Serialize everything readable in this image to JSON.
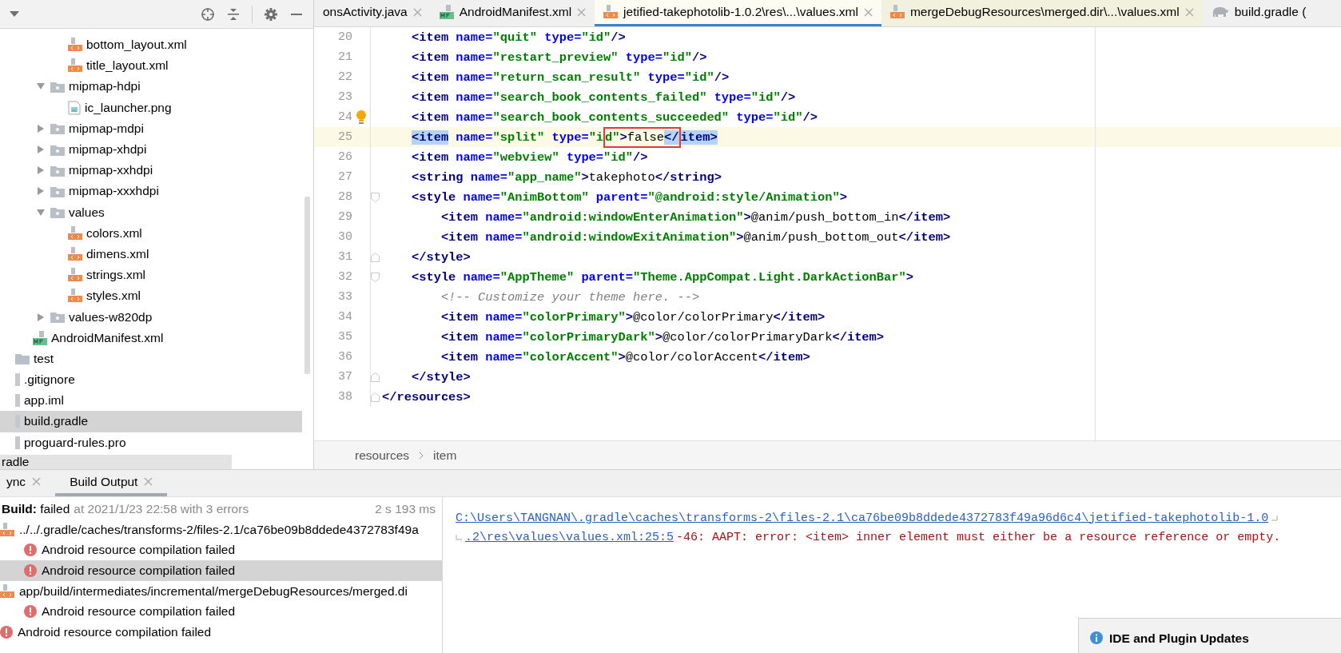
{
  "project_panel": {
    "tree": [
      {
        "children": [
          {
            "children": [
              {
                "children": [
                  {
                    "children": [
                      {
                        "label": "bottom_layout.xml",
                        "kind": "xml",
                        "selected": false
                      },
                      {
                        "label": "title_layout.xml",
                        "kind": "xml",
                        "selected": false
                      }
                    ]
                  },
                  {
                    "label": "mipmap-hdpi",
                    "kind": "folder",
                    "expanded": true,
                    "selected": false,
                    "children": [
                      {
                        "label": "ic_launcher.png",
                        "kind": "png",
                        "selected": false
                      }
                    ]
                  },
                  {
                    "label": "mipmap-mdpi",
                    "kind": "folder",
                    "expanded": false,
                    "selected": false
                  },
                  {
                    "label": "mipmap-xhdpi",
                    "kind": "folder",
                    "expanded": false,
                    "selected": false
                  },
                  {
                    "label": "mipmap-xxhdpi",
                    "kind": "folder",
                    "expanded": false,
                    "selected": false
                  },
                  {
                    "label": "mipmap-xxxhdpi",
                    "kind": "folder",
                    "expanded": false,
                    "selected": false
                  },
                  {
                    "label": "values",
                    "kind": "folder",
                    "expanded": true,
                    "selected": false,
                    "children": [
                      {
                        "label": "colors.xml",
                        "kind": "xml",
                        "selected": false
                      },
                      {
                        "label": "dimens.xml",
                        "kind": "xml",
                        "selected": false
                      },
                      {
                        "label": "strings.xml",
                        "kind": "xml",
                        "selected": false
                      },
                      {
                        "label": "styles.xml",
                        "kind": "xml",
                        "selected": false
                      }
                    ]
                  },
                  {
                    "label": "values-w820dp",
                    "kind": "folder",
                    "expanded": false,
                    "selected": false
                  }
                ]
              },
              {
                "label": "AndroidManifest.xml",
                "kind": "manifest",
                "selected": false
              }
            ]
          },
          {
            "label": "test",
            "kind": "plainfolder",
            "selected": false
          }
        ]
      },
      {
        "label": ".gitignore",
        "kind": "file",
        "selected": false
      },
      {
        "label": "app.iml",
        "kind": "file",
        "selected": false
      },
      {
        "label": "build.gradle",
        "kind": "file",
        "selected": true
      },
      {
        "label": "proguard-rules.pro",
        "kind": "file",
        "selected": false
      }
    ],
    "footer": "radle"
  },
  "editor": {
    "tabs": [
      {
        "label": "onsActivity.java",
        "kind": "plain",
        "library": false,
        "selected": false
      },
      {
        "label": "AndroidManifest.xml",
        "kind": "manifest",
        "library": false,
        "selected": false
      },
      {
        "label": "jetified-takephotolib-1.0.2\\res\\...\\values.xml",
        "kind": "xml",
        "library": true,
        "selected": true
      },
      {
        "label": "mergeDebugResources\\merged.dir\\...\\values.xml",
        "kind": "xml",
        "library": true,
        "selected": false
      },
      {
        "label": "build.gradle (",
        "kind": "gradle",
        "library": false,
        "selected": false
      }
    ],
    "lines": [
      {
        "children": [
          {
            "number": "20",
            "current": false,
            "tokens": [
              {
                "kind": "tag",
                "text": "<item"
              },
              {
                "kind": "attr",
                "text": " name="
              },
              {
                "kind": "str",
                "text": "\"quit\""
              },
              {
                "kind": "attr",
                "text": " type="
              },
              {
                "kind": "str",
                "text": "\"id\""
              },
              {
                "kind": "tag",
                "text": "/>"
              }
            ]
          },
          {
            "number": "21",
            "current": false,
            "tokens": [
              {
                "kind": "tag",
                "text": "<item"
              },
              {
                "kind": "attr",
                "text": " name="
              },
              {
                "kind": "str",
                "text": "\"restart_preview\""
              },
              {
                "kind": "attr",
                "text": " type="
              },
              {
                "kind": "str",
                "text": "\"id\""
              },
              {
                "kind": "tag",
                "text": "/>"
              }
            ]
          },
          {
            "number": "22",
            "current": false,
            "tokens": [
              {
                "kind": "tag",
                "text": "<item"
              },
              {
                "kind": "attr",
                "text": " name="
              },
              {
                "kind": "str",
                "text": "\"return_scan_result\""
              },
              {
                "kind": "attr",
                "text": " type="
              },
              {
                "kind": "str",
                "text": "\"id\""
              },
              {
                "kind": "tag",
                "text": "/>"
              }
            ]
          },
          {
            "number": "23",
            "current": false,
            "tokens": [
              {
                "kind": "tag",
                "text": "<item"
              },
              {
                "kind": "attr",
                "text": " name="
              },
              {
                "kind": "str",
                "text": "\"search_book_contents_failed\""
              },
              {
                "kind": "attr",
                "text": " type="
              },
              {
                "kind": "str",
                "text": "\"id\""
              },
              {
                "kind": "tag",
                "text": "/>"
              }
            ]
          },
          {
            "number": "24",
            "kind": "bulb",
            "current": false,
            "tokens": [
              {
                "kind": "tag",
                "text": "<item"
              },
              {
                "kind": "attr",
                "text": " name="
              },
              {
                "kind": "str",
                "text": "\"search_book_contents_succeeded\""
              },
              {
                "kind": "attr",
                "text": " type="
              },
              {
                "kind": "str",
                "text": "\"id\""
              },
              {
                "kind": "tag",
                "text": "/>"
              }
            ]
          },
          {
            "number": "25",
            "current": true,
            "tokens": [
              {
                "kind": "tag",
                "text": "<item",
                "highlighted": true,
                "boxed": false
              },
              {
                "kind": "attr",
                "text": " name=",
                "highlighted": false,
                "boxed": false
              },
              {
                "kind": "str",
                "text": "\"split\"",
                "highlighted": false,
                "boxed": false
              },
              {
                "kind": "attr",
                "text": " type=",
                "highlighted": false,
                "boxed": false
              },
              {
                "kind": "str",
                "text": "\"i",
                "highlighted": false,
                "boxed": false
              },
              {
                "kind": "str",
                "text": "d\"",
                "highlighted": false,
                "boxed": true
              },
              {
                "kind": "tag",
                "text": ">",
                "highlighted": false,
                "boxed": true
              },
              {
                "kind": "text",
                "text": "false",
                "highlighted": false,
                "boxed": true
              },
              {
                "kind": "tag",
                "text": "</",
                "highlighted": true,
                "boxed": true
              },
              {
                "kind": "tag",
                "text": "item>",
                "highlighted": true,
                "boxed": false
              }
            ]
          },
          {
            "number": "26",
            "current": false,
            "tokens": [
              {
                "kind": "tag",
                "text": "<item"
              },
              {
                "kind": "attr",
                "text": " name="
              },
              {
                "kind": "str",
                "text": "\"webview\""
              },
              {
                "kind": "attr",
                "text": " type="
              },
              {
                "kind": "str",
                "text": "\"id\""
              },
              {
                "kind": "tag",
                "text": "/>"
              }
            ]
          },
          {
            "number": "27",
            "current": false,
            "tokens": [
              {
                "kind": "tag",
                "text": "<string"
              },
              {
                "kind": "attr",
                "text": " name="
              },
              {
                "kind": "str",
                "text": "\"app_name\""
              },
              {
                "kind": "tag",
                "text": ">"
              },
              {
                "kind": "text",
                "text": "takephoto"
              },
              {
                "kind": "tag",
                "text": "</string>"
              }
            ]
          },
          {
            "number": "28",
            "kind": "fold-start",
            "current": false,
            "tokens": [
              {
                "kind": "tag",
                "text": "<style"
              },
              {
                "kind": "attr",
                "text": " name="
              },
              {
                "kind": "str",
                "text": "\"AnimBottom\""
              },
              {
                "kind": "attr",
                "text": " parent="
              },
              {
                "kind": "str",
                "text": "\"@android:style/Animation\""
              },
              {
                "kind": "tag",
                "text": ">"
              }
            ],
            "children": [
              {
                "number": "29",
                "current": false,
                "tokens": [
                  {
                    "kind": "tag",
                    "text": "<item"
                  },
                  {
                    "kind": "attr",
                    "text": " name="
                  },
                  {
                    "kind": "str",
                    "text": "\"android:windowEnterAnimation\""
                  },
                  {
                    "kind": "tag",
                    "text": ">"
                  },
                  {
                    "kind": "text",
                    "text": "@anim/push_bottom_in"
                  },
                  {
                    "kind": "tag",
                    "text": "</item>"
                  }
                ]
              },
              {
                "number": "30",
                "current": false,
                "tokens": [
                  {
                    "kind": "tag",
                    "text": "<item"
                  },
                  {
                    "kind": "attr",
                    "text": " name="
                  },
                  {
                    "kind": "str",
                    "text": "\"android:windowExitAnimation\""
                  },
                  {
                    "kind": "tag",
                    "text": ">"
                  },
                  {
                    "kind": "text",
                    "text": "@anim/push_bottom_out"
                  },
                  {
                    "kind": "tag",
                    "text": "</item>"
                  }
                ]
              }
            ]
          },
          {
            "number": "31",
            "kind": "fold-end",
            "current": false,
            "tokens": [
              {
                "kind": "tag",
                "text": "</style>"
              }
            ]
          },
          {
            "number": "32",
            "kind": "fold-start",
            "current": false,
            "tokens": [
              {
                "kind": "tag",
                "text": "<style"
              },
              {
                "kind": "attr",
                "text": " name="
              },
              {
                "kind": "str",
                "text": "\"AppTheme\""
              },
              {
                "kind": "attr",
                "text": " parent="
              },
              {
                "kind": "str",
                "text": "\"Theme.AppCompat.Light.DarkActionBar\""
              },
              {
                "kind": "tag",
                "text": ">"
              }
            ],
            "children": [
              {
                "number": "33",
                "current": false,
                "tokens": [
                  {
                    "kind": "comment",
                    "text": "<!-- Customize your theme here. -->"
                  }
                ]
              },
              {
                "number": "34",
                "current": false,
                "tokens": [
                  {
                    "kind": "tag",
                    "text": "<item"
                  },
                  {
                    "kind": "attr",
                    "text": " name="
                  },
                  {
                    "kind": "str",
                    "text": "\"colorPrimary\""
                  },
                  {
                    "kind": "tag",
                    "text": ">"
                  },
                  {
                    "kind": "text",
                    "text": "@color/colorPrimary"
                  },
                  {
                    "kind": "tag",
                    "text": "</item>"
                  }
                ]
              },
              {
                "number": "35",
                "current": false,
                "tokens": [
                  {
                    "kind": "tag",
                    "text": "<item"
                  },
                  {
                    "kind": "attr",
                    "text": " name="
                  },
                  {
                    "kind": "str",
                    "text": "\"colorPrimaryDark\""
                  },
                  {
                    "kind": "tag",
                    "text": ">"
                  },
                  {
                    "kind": "text",
                    "text": "@color/colorPrimaryDark"
                  },
                  {
                    "kind": "tag",
                    "text": "</item>"
                  }
                ]
              },
              {
                "number": "36",
                "current": false,
                "tokens": [
                  {
                    "kind": "tag",
                    "text": "<item"
                  },
                  {
                    "kind": "attr",
                    "text": " name="
                  },
                  {
                    "kind": "str",
                    "text": "\"colorAccent\""
                  },
                  {
                    "kind": "tag",
                    "text": ">"
                  },
                  {
                    "kind": "text",
                    "text": "@color/colorAccent"
                  },
                  {
                    "kind": "tag",
                    "text": "</item>"
                  }
                ]
              }
            ]
          },
          {
            "number": "37",
            "kind": "fold-end",
            "current": false,
            "tokens": [
              {
                "kind": "tag",
                "text": "</style>"
              }
            ]
          }
        ]
      },
      {
        "number": "38",
        "kind": "fold-end",
        "current": false,
        "tokens": [
          {
            "kind": "tag",
            "text": "</resources>"
          }
        ]
      }
    ],
    "breadcrumb": [
      "resources",
      "item"
    ]
  },
  "bottom_panel": {
    "tabs": [
      {
        "label": "ync",
        "selected": false
      },
      {
        "label": "Build Output",
        "selected": true
      }
    ],
    "build_tree": {
      "status": "**Build:** failed",
      "detail": "at 2021/1/23 22:58 with 3 errors",
      "time": "2 s 193 ms",
      "items": [
        {
          "label": "../../.gradle/caches/transforms-2/files-2.1/ca76be09b8ddede4372783f49a",
          "kind": "xml",
          "selected": false,
          "children": [
            {
              "label": "Android resource compilation failed",
              "kind": "error",
              "selected": false
            },
            {
              "label": "Android resource compilation failed",
              "kind": "error",
              "selected": true
            }
          ]
        },
        {
          "label": "app/build/intermediates/incremental/mergeDebugResources/merged.di",
          "kind": "xml",
          "selected": false,
          "children": [
            {
              "label": "Android resource compilation failed",
              "kind": "error",
              "selected": false
            }
          ]
        },
        {
          "label": "Android resource compilation failed",
          "kind": "error",
          "selected": false
        }
      ]
    },
    "console": [
      {
        "link": "C:\\Users\\TANGNAN\\.gradle\\caches\\transforms-2\\files-2.1\\ca76be09b8ddede4372783f49a96d6c4\\jetified-takephotolib-1.0",
        "wrap_end": true
      },
      {
        "link": ".2\\res\\values\\values.xml:25:5",
        "message": "-46: AAPT: error: <item> inner element must either be a resource reference or empty.",
        "wrap_start": true
      }
    ]
  },
  "notification": {
    "title": "IDE and Plugin Updates"
  }
}
